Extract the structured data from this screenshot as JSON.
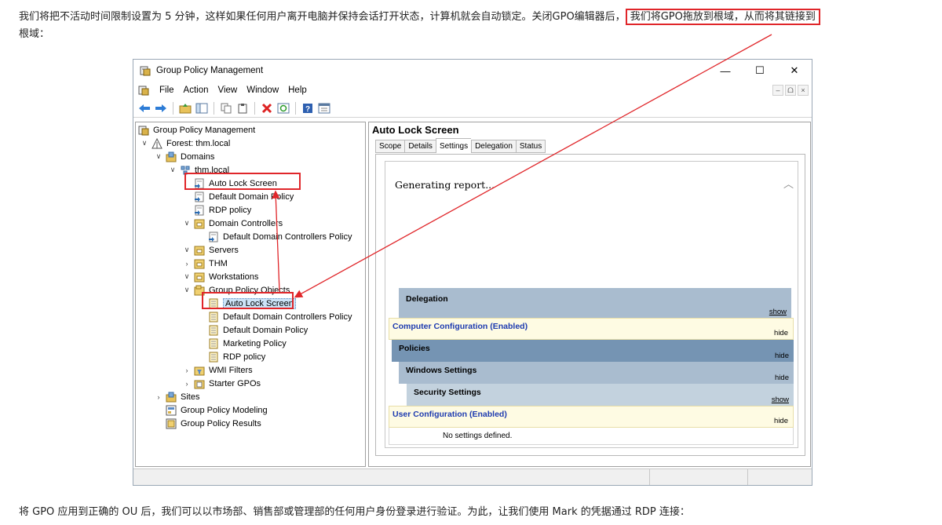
{
  "article": {
    "para_top_a": "我们将把不活动时间限制设置为 5 分钟，这样如果任何用户离开电脑并保持会话打开状态，计算机就会自动锁定。关闭GPO编辑器后，",
    "para_top_highlight": "我们将GPO拖放到根域，从而将其链接到",
    "para_top_b": "根域：",
    "para_bottom": "将 GPO 应用到正确的 OU 后，我们可以以市场部、销售部或管理部的任何用户身份登录进行验证。为此，让我们使用 Mark 的凭据通过 RDP 连接："
  },
  "window": {
    "title": "Group Policy Management",
    "controls": {
      "minimize": "—",
      "maximize": "☐",
      "close": "✕"
    },
    "mdi_controls": {
      "minimize": "–",
      "restore": "ᗝ",
      "close": "×"
    },
    "menu": [
      "File",
      "Action",
      "View",
      "Window",
      "Help"
    ]
  },
  "tree": {
    "root": "Group Policy Management",
    "forest": "Forest: thm.local",
    "domains": "Domains",
    "domain": "thm.local",
    "linked_gpos": [
      "Auto Lock Screen",
      "Default Domain Policy",
      "RDP policy"
    ],
    "ou_domain_controllers": "Domain Controllers",
    "gpo_dc_policy": "Default Domain Controllers Policy",
    "ou_servers": "Servers",
    "ou_thm": "THM",
    "ou_workstations": "Workstations",
    "gpo_container": "Group Policy Objects",
    "gpo_objects": [
      "Auto Lock Screen",
      "Default Domain Controllers Policy",
      "Default Domain Policy",
      "Marketing Policy",
      "RDP policy"
    ],
    "wmi_filters": "WMI Filters",
    "starter_gpos": "Starter GPOs",
    "sites": "Sites",
    "modeling": "Group Policy Modeling",
    "results": "Group Policy Results"
  },
  "detail": {
    "title": "Auto Lock Screen",
    "tabs": [
      "Scope",
      "Details",
      "Settings",
      "Delegation",
      "Status"
    ],
    "active_tab": "Settings",
    "generating": "Generating report...",
    "sections": {
      "delegation": "Delegation",
      "computer_config": "Computer Configuration (Enabled)",
      "policies": "Policies",
      "windows_settings": "Windows Settings",
      "security_settings": "Security Settings",
      "user_config": "User Configuration (Enabled)",
      "no_settings": "No settings defined."
    },
    "actions": {
      "show": "show",
      "hide": "hide"
    }
  },
  "colors": {
    "annotation_red": "#e0262a",
    "band_delegation": "#a9bccf",
    "band_policies": "#7594b3",
    "band_windows": "#a9bccf",
    "band_security": "#c3d2de",
    "config_yellow": "#fefbe3",
    "config_text": "#1e3bb0"
  }
}
